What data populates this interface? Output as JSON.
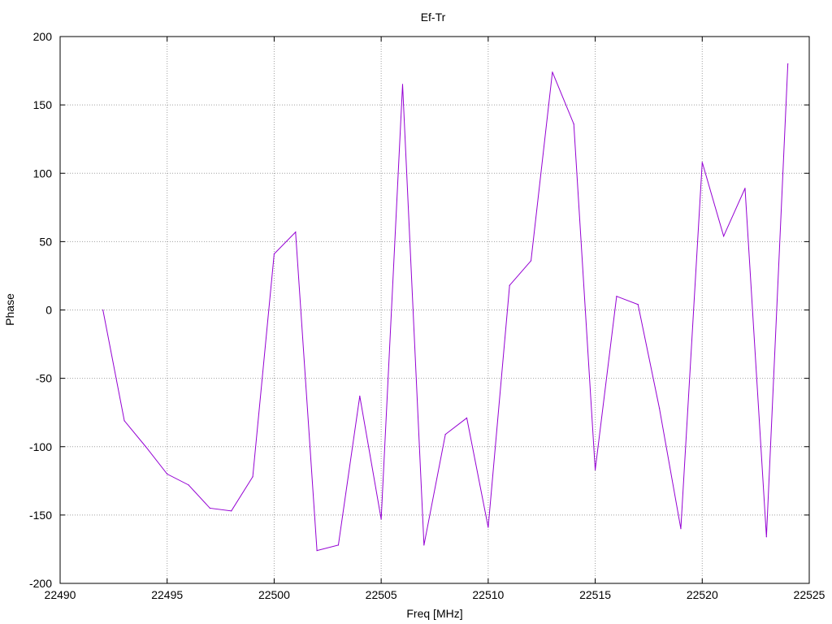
{
  "chart_data": {
    "type": "line",
    "title": "Ef-Tr",
    "xlabel": "Freq [MHz]",
    "ylabel": "Phase",
    "xlim": [
      22490,
      22525
    ],
    "ylim": [
      -200,
      200
    ],
    "xticks": [
      22490,
      22495,
      22500,
      22505,
      22510,
      22515,
      22520,
      22525
    ],
    "yticks": [
      -200,
      -150,
      -100,
      -50,
      0,
      50,
      100,
      150,
      200
    ],
    "grid": true,
    "line_color": "#9400d3",
    "series": [
      {
        "x": [
          22492,
          22493,
          22494,
          22495,
          22496,
          22497,
          22498,
          22499,
          22500,
          22501,
          22502,
          22503,
          22504,
          22505,
          22506,
          22507,
          22508,
          22509,
          22510,
          22511,
          22512,
          22513,
          22514,
          22515,
          22516,
          22517,
          22518,
          22519,
          22520,
          22521,
          22522,
          22523,
          22524
        ],
        "y": [
          0,
          -81,
          -100,
          -120,
          -128,
          -145,
          -147,
          -122,
          41,
          57,
          -176,
          -172,
          -63,
          -153,
          165,
          -172,
          -91,
          -79,
          -159,
          18,
          36,
          174,
          136,
          -117,
          10,
          4,
          -72,
          -160,
          108,
          54,
          89,
          -166,
          180
        ]
      }
    ]
  }
}
